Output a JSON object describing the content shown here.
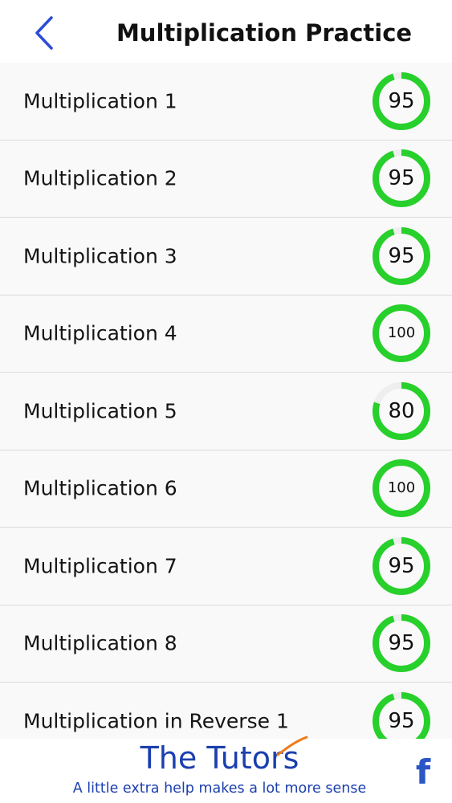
{
  "navbar": {
    "title": "Multiplication Practice",
    "back_icon": "chevron-left-icon",
    "accent": "#2b4bd6"
  },
  "list": {
    "items": [
      {
        "label": "Multiplication 1",
        "score": "95",
        "progress": 0.95
      },
      {
        "label": "Multiplication 2",
        "score": "95",
        "progress": 0.95
      },
      {
        "label": "Multiplication 3",
        "score": "95",
        "progress": 0.95
      },
      {
        "label": "Multiplication 4",
        "score": "100",
        "progress": 1.0
      },
      {
        "label": "Multiplication 5",
        "score": "80",
        "progress": 0.8
      },
      {
        "label": "Multiplication 6",
        "score": "100",
        "progress": 1.0
      },
      {
        "label": "Multiplication 7",
        "score": "95",
        "progress": 0.95
      },
      {
        "label": "Multiplication 8",
        "score": "95",
        "progress": 0.95
      },
      {
        "label": "Multiplication in Reverse 1",
        "score": "95",
        "progress": 0.95
      }
    ],
    "ring_color": "#27d02b",
    "ring_track_color": "#eeeeee"
  },
  "footer": {
    "brand": "The Tutors",
    "tagline": "A little extra help makes a lot more sense",
    "facebook_icon": "facebook-icon",
    "facebook_glyph": "f",
    "brand_color": "#1b3fae",
    "swoosh_color": "#f07a1a"
  }
}
